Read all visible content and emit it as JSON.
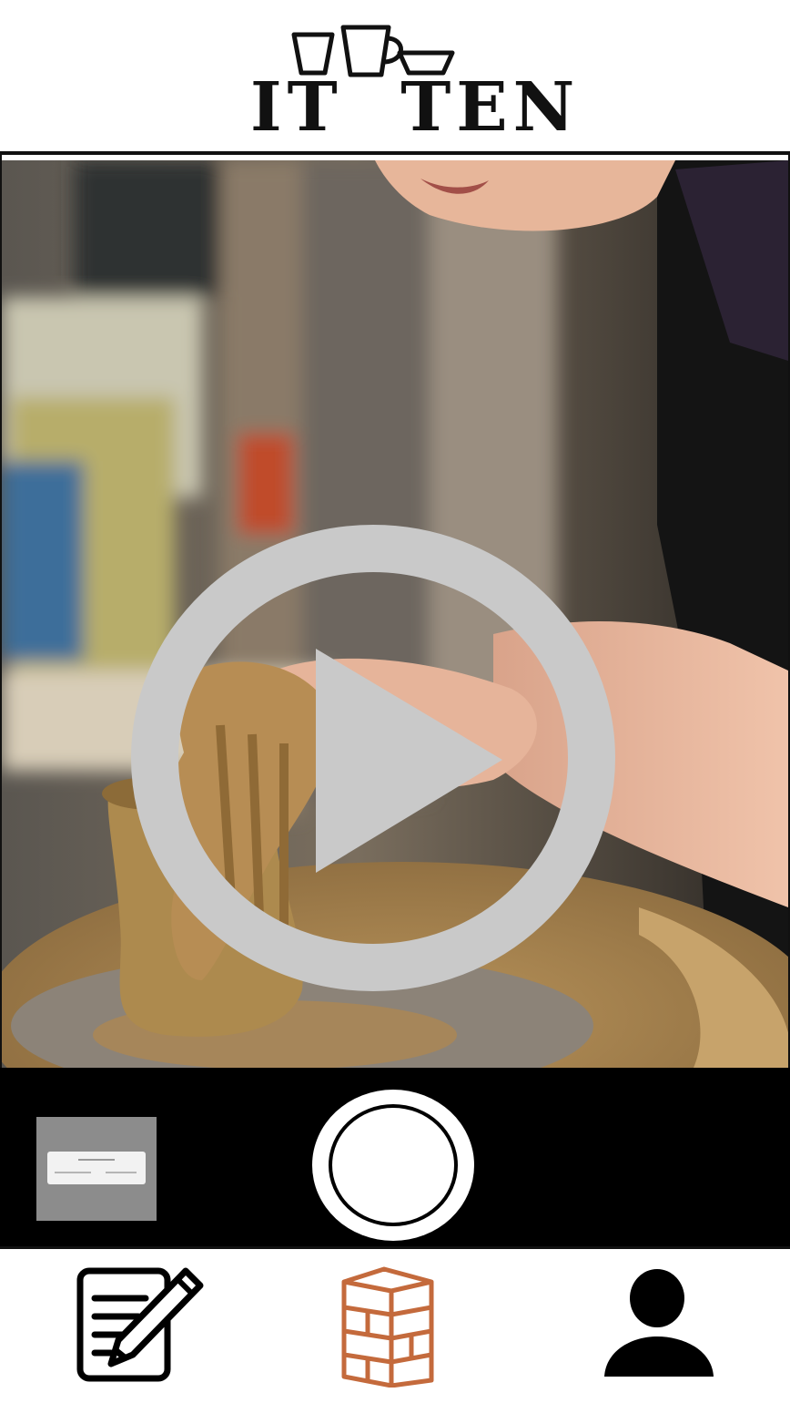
{
  "app": {
    "logo_text": "IT  TEN",
    "accent_color": "#c46a3c"
  },
  "preview": {
    "play_icon": "play-circle-icon"
  },
  "camera": {
    "gallery_icon": "gallery-thumbnail",
    "shutter_icon": "shutter-button"
  },
  "nav": {
    "items": [
      {
        "icon": "notepad-pencil-icon"
      },
      {
        "icon": "shelf-icon",
        "active": true
      },
      {
        "icon": "user-icon"
      }
    ]
  }
}
